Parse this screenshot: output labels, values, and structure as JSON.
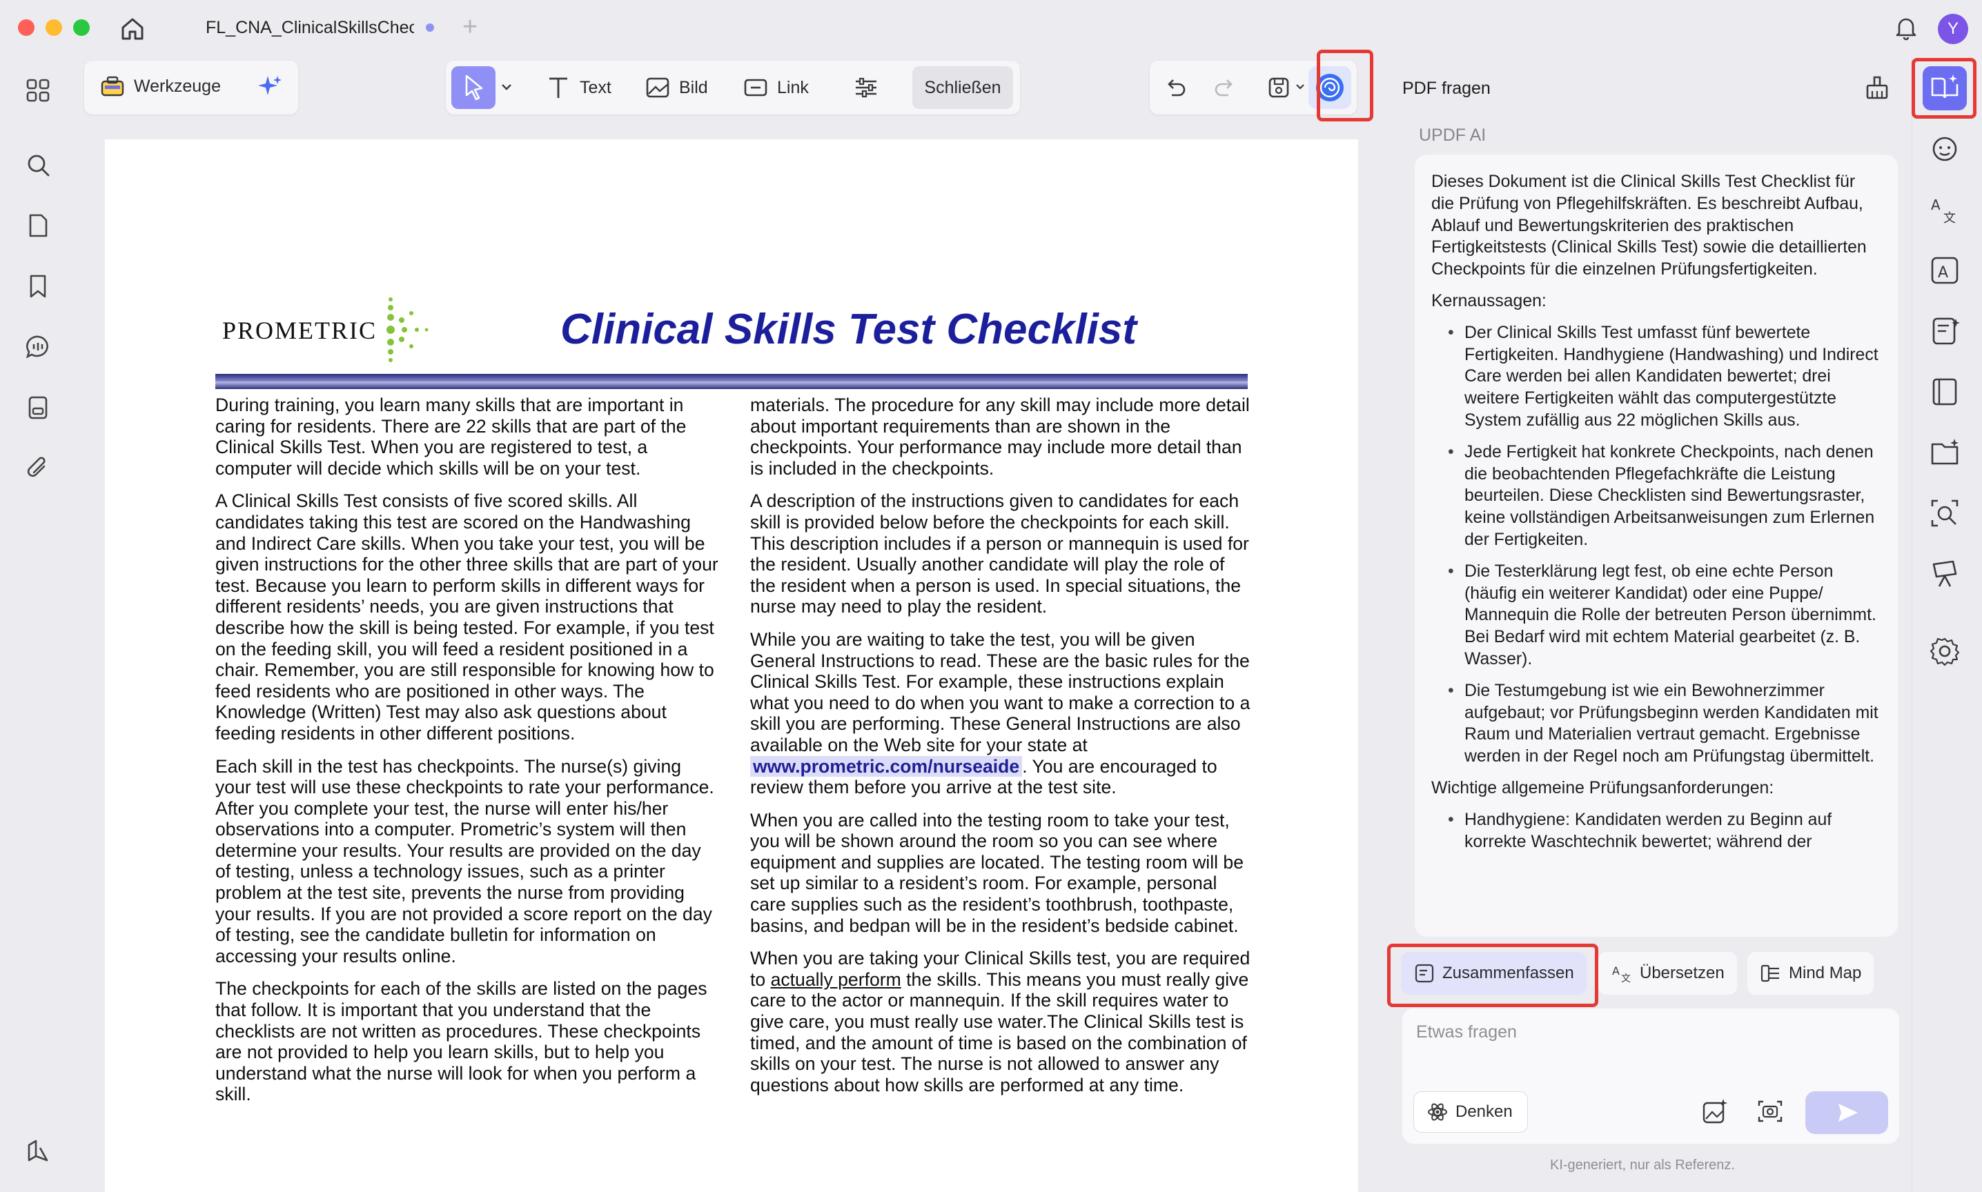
{
  "window": {
    "tab_title": "FL_CNA_ClinicalSkillsChec",
    "avatar_letter": "Y"
  },
  "toolbar": {
    "tools_label": "Werkzeuge",
    "text_label": "Text",
    "image_label": "Bild",
    "link_label": "Link",
    "close_label": "Schließen"
  },
  "document": {
    "logo_text": "PROMETRIC",
    "title": "Clinical Skills Test Checklist",
    "left_column": [
      "During training, you learn many skills that are important in caring for residents. There are 22 skills that are part of the Clinical Skills Test. When you are registered to test, a computer will decide which skills will be on your test.",
      "A Clinical Skills Test consists of five scored skills. All candidates taking this test are scored on the Handwashing and Indirect Care skills. When you take your test, you will be given instructions for the other three skills that are part of your test. Because you learn to perform skills in different ways for different residents’ needs, you are given instructions that describe how the skill is being tested. For example, if you test on the feeding skill, you will feed a resident positioned in a chair. Remember, you are still responsible for knowing how to feed residents who are positioned in other ways. The Knowledge (Written) Test may also ask questions about feeding residents in other different positions.",
      "Each skill in the test has checkpoints. The nurse(s) giving your test will use these checkpoints to rate your performance. After you complete your test, the nurse will enter his/her observations into a computer. Prometric’s system will then determine your results. Your results are provided on the day of testing, unless a technology issues, such as a printer problem at the test site, prevents the nurse from providing your results. If you are not provided a score report on the day of testing, see the candidate bulletin for information on accessing your results online.",
      "The checkpoints for each of the skills are listed on the pages that follow. It is important that you understand that the checklists are not written as procedures. These checkpoints are not provided to help you learn skills, but to help you understand what the nurse will look for when you perform a skill."
    ],
    "right_column": {
      "p1": "materials. The procedure for any skill may include more detail about important requirements than are shown in the checkpoints. Your performance may include more detail than is included in the checkpoints.",
      "p2": "A description of the instructions given to candidates for each skill is provided below before the checkpoints for each skill. This description includes if a person or mannequin is used for the resident. Usually another candidate will play the role of the resident when a person is used. In special situations, the nurse may need to play the resident.",
      "p3_before": "While you are waiting to take the test, you will be given General Instructions to read. These are the basic rules for the Clinical Skills Test. For example, these instructions explain what you need to do when you want to make a correction to a skill you are performing. These General Instructions are also available on the Web site for your state at",
      "p3_link": "www.prometric.com/nurseaide",
      "p3_after": ". You are encouraged to review them before you arrive at the test site.",
      "p4": "When you are called into the testing room to take your test, you will be shown around the room so you can see where equipment and supplies are located. The testing room will be set up similar to a resident’s room. For example, personal care supplies such as the resident’s toothbrush, toothpaste, basins, and bedpan will be in the resident’s bedside cabinet.",
      "p5_before": "When you are taking your Clinical Skills test, you are required to",
      "p5_underline": "actually perform",
      "p5_after": "the skills. This means you must really give care to the actor or mannequin. If the skill requires water to give care, you must really use water.The Clinical Skills test is timed, and the amount of time is based on the combination of skills on your test. The nurse is not allowed to answer any questions about how skills are performed at any time."
    }
  },
  "ai_panel": {
    "title": "PDF fragen",
    "subtitle": "UPDF AI",
    "intro": "Dieses Dokument ist die Clinical Skills Test Checklist für die Prüfung von Pflegehilfskräften. Es beschreibt Aufbau, Ablauf und Bewertungskriterien des praktischen Fertigkeitstests (Clinical Skills Test) sowie die detaillierten Checkpoints für die einzelnen Prüfungsfertigkeiten.",
    "key_heading": "Kernaussagen:",
    "key_points": [
      "Der Clinical Skills Test umfasst fünf bewertete Fertigkeiten. Handhygiene (Handwashing) und Indirect Care werden bei allen Kandidaten bewertet; drei weitere Fertigkeiten wählt das computergestützte System zufällig aus 22 möglichen Skills aus.",
      "Jede Fertigkeit hat konkrete Checkpoints, nach denen die beobachtenden Pflegefachkräfte die Leistung beurteilen. Diese Checklisten sind Bewertungsraster, keine vollständigen Arbeitsanweisungen zum Erlernen der Fertigkeiten.",
      "Die Testerklärung legt fest, ob eine echte Person (häufig ein weiterer Kandidat) oder eine Puppe/ Mannequin die Rolle der betreuten Person übernimmt. Bei Bedarf wird mit echtem Material gearbeitet (z. B. Wasser).",
      "Die Testumgebung ist wie ein Bewohnerzimmer aufgebaut; vor Prüfungsbeginn werden Kandidaten mit Raum und Materialien vertraut gemacht. Ergebnisse werden in der Regel noch am Prüfungstag übermittelt."
    ],
    "requirements_heading": "Wichtige allgemeine Prüfungsanforderungen:",
    "requirements": [
      "Handhygiene: Kandidaten werden zu Beginn auf korrekte Waschtechnik bewertet; während der"
    ],
    "chips": {
      "summarize": "Zusammenfassen",
      "translate": "Übersetzen",
      "mindmap": "Mind Map"
    },
    "input_placeholder": "Etwas fragen",
    "think_label": "Denken",
    "footnote": "KI-generiert, nur als Referenz."
  },
  "colors": {
    "accent": "#6b6ef0",
    "title_blue": "#1c1f9c",
    "highlight_red": "#e53935"
  }
}
